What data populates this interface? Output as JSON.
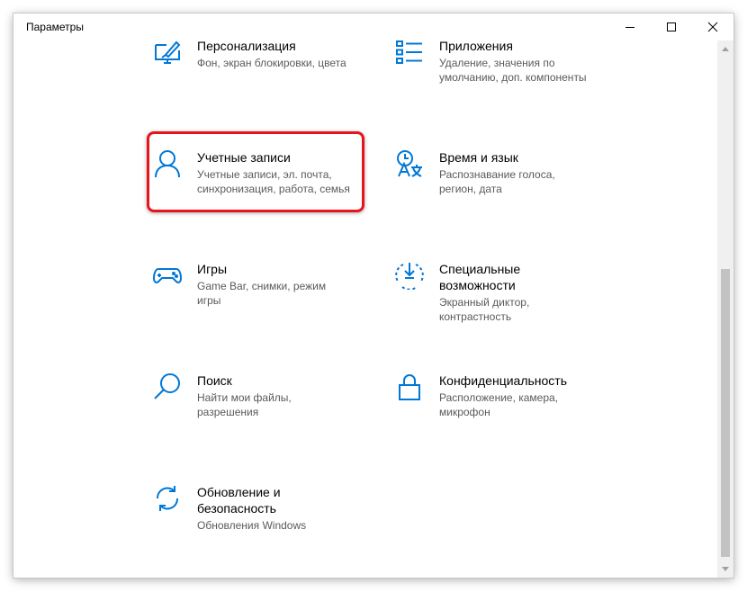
{
  "window": {
    "title": "Параметры",
    "accent_color": "#0078d7",
    "highlight_color": "#e8131b"
  },
  "categories": [
    {
      "id": "personalization",
      "icon": "brush-monitor-icon",
      "title": "Персонализация",
      "desc": [
        "Фон, экран блокировки, цвета"
      ]
    },
    {
      "id": "apps",
      "icon": "apps-list-icon",
      "title": "Приложения",
      "desc": [
        "Удаление, значения по",
        "умолчанию, доп. компоненты"
      ]
    },
    {
      "id": "accounts",
      "icon": "person-icon",
      "title": "Учетные записи",
      "desc": [
        "Учетные записи, эл. почта,",
        "синхронизация, работа, семья"
      ]
    },
    {
      "id": "time-language",
      "icon": "time-language-icon",
      "title": "Время и язык",
      "desc": [
        "Распознавание голоса,",
        "регион, дата"
      ]
    },
    {
      "id": "gaming",
      "icon": "gamepad-icon",
      "title": "Игры",
      "desc": [
        "Game Bar, снимки, режим",
        "игры"
      ]
    },
    {
      "id": "ease-of-access",
      "icon": "ease-of-access-icon",
      "title_lines": [
        "Специальные",
        "возможности"
      ],
      "desc": [
        "Экранный диктор,",
        "контрастность"
      ]
    },
    {
      "id": "search",
      "icon": "magnifier-icon",
      "title": "Поиск",
      "desc": [
        "Найти мои файлы,",
        "разрешения"
      ]
    },
    {
      "id": "privacy",
      "icon": "lock-icon",
      "title": "Конфиденциальность",
      "desc": [
        "Расположение, камера,",
        "микрофон"
      ]
    },
    {
      "id": "update-security",
      "icon": "sync-arrows-icon",
      "title_lines": [
        "Обновление и",
        "безопасность"
      ],
      "desc": [
        "Обновления Windows"
      ]
    }
  ]
}
